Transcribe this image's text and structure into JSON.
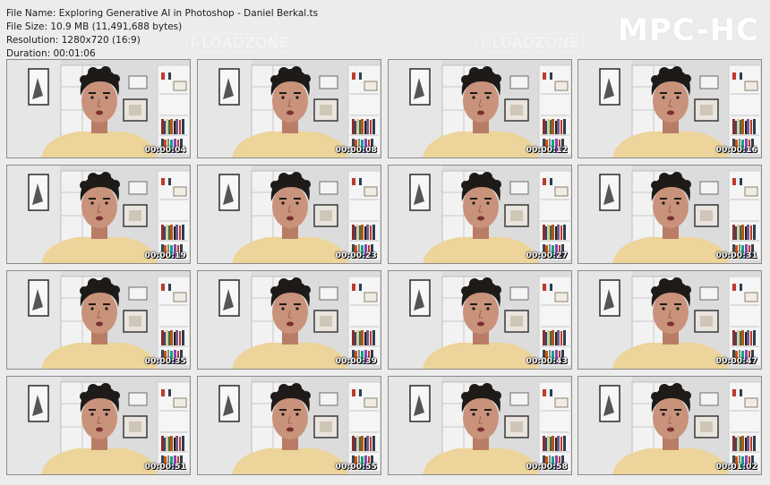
{
  "info": {
    "filename": "File Name: Exploring Generative AI in Photoshop - Daniel Berkal.ts",
    "filesize": "File Size: 10.9 MB (11,491,688 bytes)",
    "resolution": "Resolution: 1280x720 (16:9)",
    "duration": "Duration: 00:01:06"
  },
  "logo": "MPC-HC",
  "watermark": "I-LOADZONE",
  "colors": {
    "page_bg": "#ececec",
    "wall": "#dcdcdc",
    "shirt": "#ecd49a",
    "skin": "#c9927a",
    "hair": "#1e1a18"
  },
  "thumbnails": [
    {
      "timestamp": "00:00:04"
    },
    {
      "timestamp": "00:00:08"
    },
    {
      "timestamp": "00:00:12"
    },
    {
      "timestamp": "00:00:16"
    },
    {
      "timestamp": "00:00:19"
    },
    {
      "timestamp": "00:00:23"
    },
    {
      "timestamp": "00:00:27"
    },
    {
      "timestamp": "00:00:31"
    },
    {
      "timestamp": "00:00:35"
    },
    {
      "timestamp": "00:00:39"
    },
    {
      "timestamp": "00:00:43"
    },
    {
      "timestamp": "00:00:47"
    },
    {
      "timestamp": "00:00:51"
    },
    {
      "timestamp": "00:00:55"
    },
    {
      "timestamp": "00:00:58"
    },
    {
      "timestamp": "00:01:02"
    }
  ]
}
